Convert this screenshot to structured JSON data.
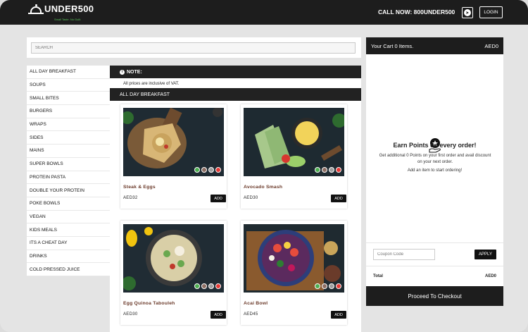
{
  "header": {
    "logo_text": "UNDER500",
    "logo_tagline": "Small Taste. No Guilt.",
    "call_text": "CALL NOW: 800UNDER500",
    "login_label": "LOGIN"
  },
  "search": {
    "placeholder": "SEARCH"
  },
  "sidebar": {
    "items": [
      {
        "label": "ALL DAY BREAKFAST"
      },
      {
        "label": "SOUPS"
      },
      {
        "label": "SMALL BITES"
      },
      {
        "label": "BURGERS"
      },
      {
        "label": "WRAPS"
      },
      {
        "label": "SIDES"
      },
      {
        "label": "MAINS"
      },
      {
        "label": "SUPER BOWLS"
      },
      {
        "label": "PROTEIN PASTA"
      },
      {
        "label": "DOUBLE YOUR PROTEIN"
      },
      {
        "label": "POKE BOWLS"
      },
      {
        "label": "VEGAN"
      },
      {
        "label": "KIDS MEALS"
      },
      {
        "label": "ITS A CHEAT DAY"
      },
      {
        "label": "DRINKS"
      },
      {
        "label": "COLD PRESSED JUICE"
      }
    ]
  },
  "main": {
    "note_title": "NOTE:",
    "note_text": "All prices are inclusive of VAT.",
    "category_title": "ALL DAY BREAKFAST",
    "add_label": "ADD",
    "products": [
      {
        "name": "Steak & Eggs",
        "price": "AED32"
      },
      {
        "name": "Avocado Smash",
        "price": "AED30"
      },
      {
        "name": "Egg Quinoa Tabouleh",
        "price": "AED30"
      },
      {
        "name": "Acai Bowl",
        "price": "AED45"
      }
    ]
  },
  "cart": {
    "title": "Your Cart 0 Items.",
    "amount": "AED0",
    "earn_title": "Earn Points on every order!",
    "earn_subtitle": "Get additional 0 Points on your first order and avail discount on your next order.",
    "earn_hint": "Add an item to start ordering!",
    "coupon_placeholder": "Coupon Code",
    "apply_label": "APPLY",
    "total_label": "Total",
    "total_value": "AED0",
    "checkout_label": "Proceed To Checkout"
  },
  "colors": {
    "dark": "#1d1d1d",
    "accent_green": "#59c25a",
    "product_name": "#6b3a2a"
  }
}
